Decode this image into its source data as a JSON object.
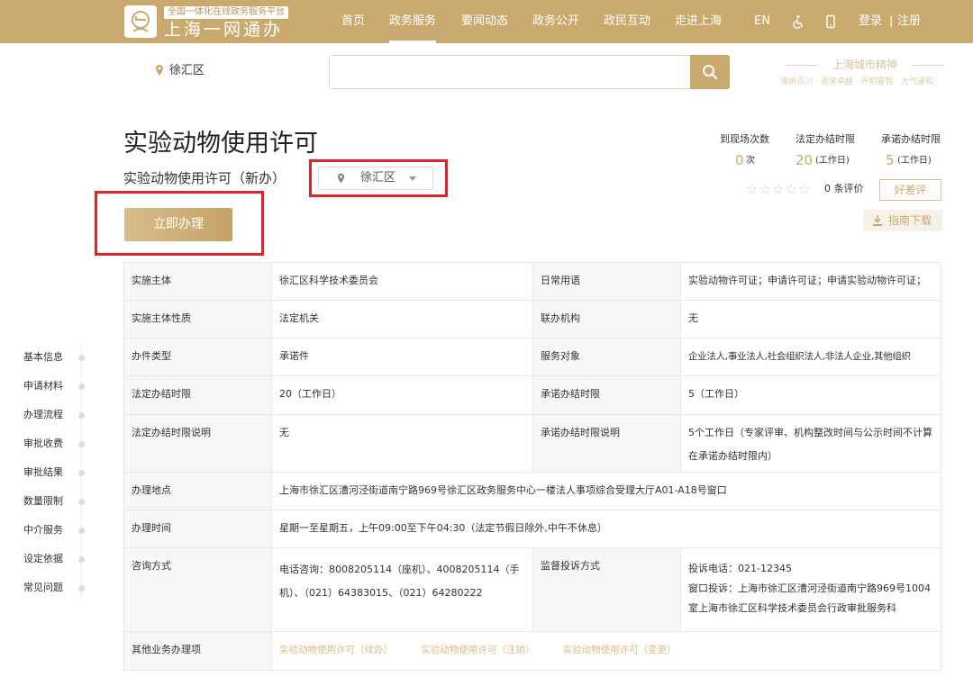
{
  "header": {
    "brand_small": "全国一体化在线政务服务平台",
    "brand_big": "上海一网通办",
    "nav": [
      "首页",
      "政务服务",
      "要闻动态",
      "政务公开",
      "政民互动",
      "走进上海"
    ],
    "nav_active_index": 1,
    "lang": "EN",
    "login": "登录",
    "register": "注册",
    "login_sep": "|"
  },
  "search": {
    "location": "徐汇区",
    "placeholder": ""
  },
  "city_spirit": {
    "title": "上海城市精神",
    "subtitle": "海纳百川 · 追求卓越 · 开明睿智 · 大气谦和"
  },
  "service": {
    "title": "实验动物使用许可",
    "subtitle": "实验动物使用许可（新办）",
    "district": "徐汇区",
    "apply_button": "立即办理"
  },
  "stats": [
    {
      "label": "到现场次数",
      "value": "0",
      "unit": "次"
    },
    {
      "label": "法定办结时限",
      "value": "20",
      "unit": "(工作日)"
    },
    {
      "label": "承诺办结时限",
      "value": "5",
      "unit": "(工作日)"
    }
  ],
  "rating": {
    "stars": "☆☆☆☆☆",
    "count_text": "0 条评价",
    "review_button": "好差评",
    "guide_download": "指南下载"
  },
  "sidenav": [
    "基本信息",
    "申请材料",
    "办理流程",
    "审批收费",
    "审批结果",
    "数量限制",
    "中介服务",
    "设定依据",
    "常见问题"
  ],
  "table": {
    "r1": {
      "l1": "实施主体",
      "v1": "徐汇区科学技术委员会",
      "l2": "日常用语",
      "v2": "实验动物许可证；申请许可证；申请实验动物许可证；"
    },
    "r2": {
      "l1": "实施主体性质",
      "v1": "法定机关",
      "l2": "联办机构",
      "v2": "无"
    },
    "r3": {
      "l1": "办件类型",
      "v1": "承诺件",
      "l2": "服务对象",
      "v2": "企业法人,事业法人,社会组织法人,非法人企业,其他组织"
    },
    "r4": {
      "l1": "法定办结时限",
      "v1": "20（工作日）",
      "l2": "承诺办结时限",
      "v2": "5（工作日）"
    },
    "r5": {
      "l1": "法定办结时限说明",
      "v1": "无",
      "l2": "承诺办结时限说明",
      "v2": "5个工作日（专家评审、机构整改时间与公示时间不计算在承诺办结时限内）"
    },
    "r6": {
      "l1": "办理地点",
      "v1": "上海市徐汇区漕河泾街道南宁路969号徐汇区政务服务中心一楼法人事项综合受理大厅A01-A18号窗口"
    },
    "r7": {
      "l1": "办理时间",
      "v1": "星期一至星期五，上午09:00至下午04:30（法定节假日除外,中午不休息）"
    },
    "r8": {
      "l1": "咨询方式",
      "v1": "电话咨询：8008205114（座机）、4008205114（手机）、（021）64383015、（021）64280222",
      "l2": "监督投诉方式",
      "v2a": "投诉电话：021-12345",
      "v2b": "窗口投诉：上海市徐汇区漕河泾街道南宁路969号1004室上海市徐汇区科学技术委员会行政审批服务科"
    },
    "r9": {
      "l1": "其他业务办理项",
      "links": [
        "实验动物使用许可（续办）",
        "实验动物使用许可（注销）",
        "实验动物使用许可（变更）"
      ]
    }
  },
  "colors": {
    "brand_gold": "#c9a96e",
    "highlight_red": "#d9262c"
  }
}
